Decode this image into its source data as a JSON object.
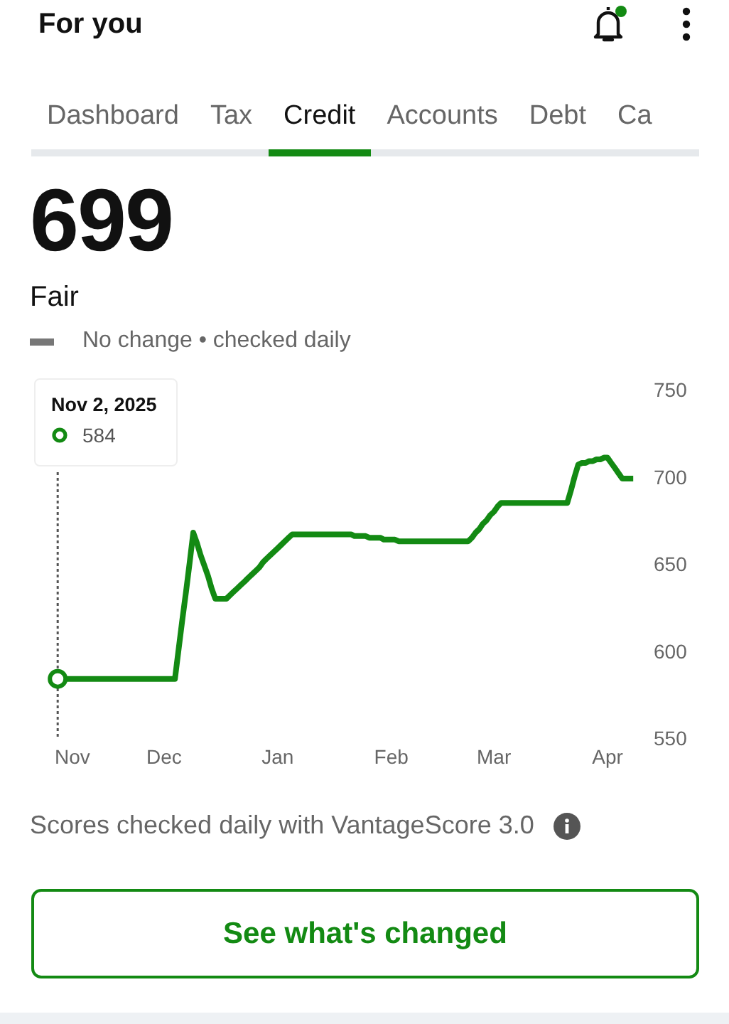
{
  "header": {
    "title": "For you",
    "notification_dot": true
  },
  "tabs": [
    {
      "label": "Dashboard",
      "selected": false
    },
    {
      "label": "Tax",
      "selected": false
    },
    {
      "label": "Credit",
      "selected": true
    },
    {
      "label": "Accounts",
      "selected": false
    },
    {
      "label": "Debt",
      "selected": false
    },
    {
      "label": "Ca",
      "selected": false
    }
  ],
  "score": {
    "value": "699",
    "rating": "Fair",
    "change": "No change • checked daily"
  },
  "chart": {
    "tooltip": {
      "date": "Nov 2, 2025",
      "value": "584"
    },
    "chart_data": {
      "type": "line",
      "categories": [
        null,
        null,
        null,
        null,
        "Nov",
        null,
        null,
        null,
        null,
        null,
        null,
        null,
        null,
        null,
        null,
        null,
        null,
        null,
        null,
        null,
        null,
        null,
        null,
        null,
        null,
        null,
        null,
        null,
        null,
        "Dec",
        null,
        null,
        null,
        null,
        null,
        null,
        null,
        null,
        null,
        null,
        null,
        null,
        null,
        null,
        null,
        null,
        null,
        null,
        null,
        null,
        null,
        null,
        null,
        null,
        null,
        null,
        null,
        null,
        null,
        null,
        "Jan",
        null,
        null,
        null,
        null,
        null,
        null,
        null,
        null,
        null,
        null,
        null,
        null,
        null,
        null,
        null,
        null,
        null,
        null,
        null,
        null,
        null,
        null,
        null,
        null,
        null,
        null,
        null,
        null,
        null,
        null,
        "Feb",
        null,
        null,
        null,
        null,
        null,
        null,
        null,
        null,
        null,
        null,
        null,
        null,
        null,
        null,
        null,
        null,
        null,
        null,
        null,
        null,
        null,
        null,
        null,
        null,
        null,
        null,
        null,
        "Mar",
        null,
        null,
        null,
        null,
        null,
        null,
        null,
        null,
        null,
        null,
        null,
        null,
        null,
        null,
        null,
        null,
        null,
        null,
        null,
        null,
        null,
        null,
        null,
        null,
        null,
        null,
        null,
        null,
        null,
        null,
        "Apr",
        null,
        null,
        null,
        null,
        null,
        null,
        null
      ],
      "series": [
        {
          "color": "#138a13",
          "values": [
            584,
            584,
            584,
            584,
            584,
            584,
            584,
            584,
            584,
            584,
            584,
            584,
            584,
            584,
            584,
            584,
            584,
            584,
            584,
            584,
            584,
            584,
            584,
            584,
            584,
            584,
            584,
            584,
            584,
            584,
            584,
            584,
            584,
            601,
            618,
            634,
            651,
            668,
            662,
            655,
            649,
            643,
            636,
            630,
            630,
            630,
            630,
            632,
            634,
            636,
            638,
            640,
            642,
            644,
            646,
            648,
            651,
            653,
            655,
            657,
            659,
            661,
            663,
            665,
            667,
            667,
            667,
            667,
            667,
            667,
            667,
            667,
            667,
            667,
            667,
            667,
            667,
            667,
            667,
            667,
            667,
            666,
            666,
            666,
            666,
            665,
            665,
            665,
            665,
            664,
            664,
            664,
            664,
            663,
            663,
            663,
            663,
            663,
            663,
            663,
            663,
            663,
            663,
            663,
            663,
            663,
            663,
            663,
            663,
            663,
            663,
            663,
            663,
            665,
            668,
            670,
            673,
            675,
            678,
            680,
            683,
            685,
            685,
            685,
            685,
            685,
            685,
            685,
            685,
            685,
            685,
            685,
            685,
            685,
            685,
            685,
            685,
            685,
            685,
            685,
            692,
            700,
            707,
            708,
            708,
            709,
            709,
            710,
            710,
            711,
            711,
            708,
            705,
            702,
            699,
            699,
            699,
            699
          ]
        }
      ],
      "ylim": [
        550,
        750
      ],
      "yticks": [
        550,
        600,
        650,
        700,
        750
      ]
    }
  },
  "footnote": "Scores checked daily with VantageScore 3.0",
  "button": "See what's changed"
}
